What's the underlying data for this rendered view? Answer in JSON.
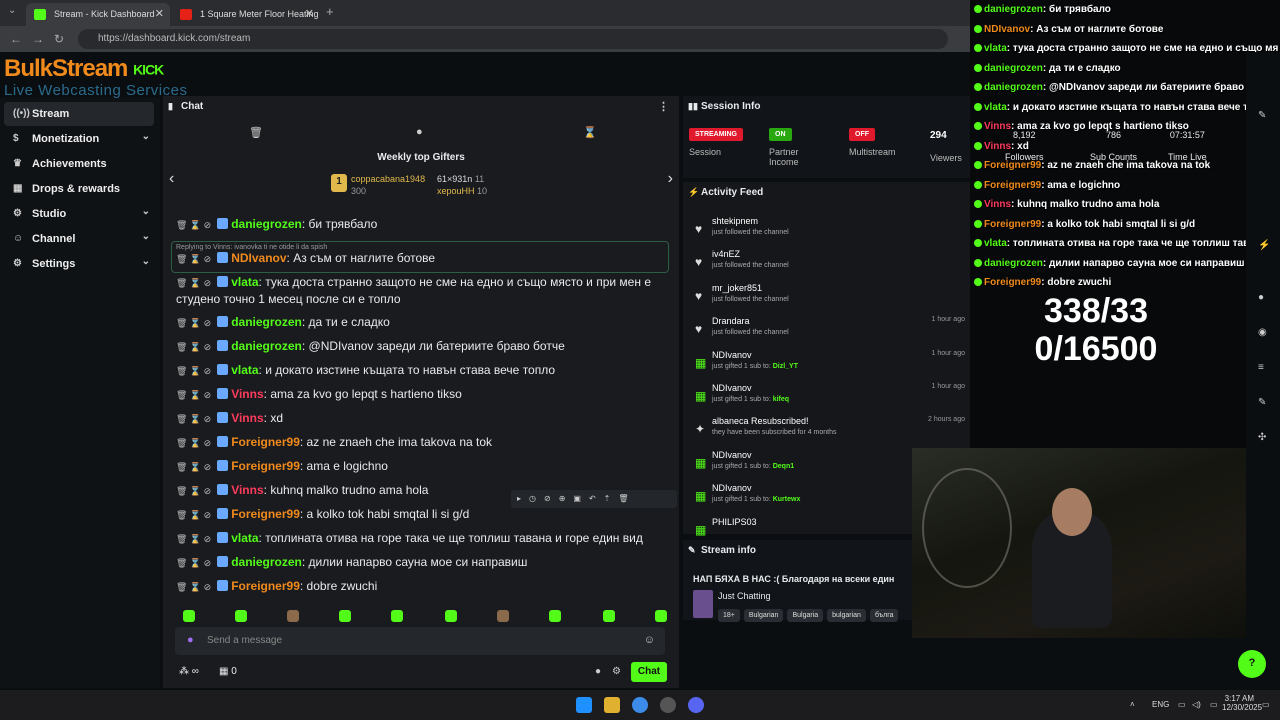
{
  "browser": {
    "tabs": [
      {
        "title": "Stream - Kick Dashboard"
      },
      {
        "title": "1 Square Meter Floor Heating"
      }
    ],
    "url": "https://dashboard.kick.com/stream"
  },
  "logo": {
    "line1": "BulkStream",
    "kick": "KICK",
    "line2": "Live Webcasting Services"
  },
  "sidebar": {
    "items": [
      {
        "label": "Stream",
        "icon": "radio-icon"
      },
      {
        "label": "Monetization",
        "icon": "dollar-icon"
      },
      {
        "label": "Achievements",
        "icon": "trophy-icon"
      },
      {
        "label": "Drops & rewards",
        "icon": "gift-icon"
      },
      {
        "label": "Studio",
        "icon": "gear-icon"
      },
      {
        "label": "Channel",
        "icon": "user-icon"
      },
      {
        "label": "Settings",
        "icon": "settings-icon"
      }
    ]
  },
  "chat": {
    "title": "Chat",
    "gifters_title": "Weekly top Gifters",
    "gifters": [
      {
        "name": "coppacabana1948",
        "count": "300"
      },
      {
        "name": "61×931n",
        "count": "11"
      },
      {
        "name": "хepouHH",
        "count": "10"
      }
    ],
    "reply_to": "Replying to Vinns: ivanovka ti ne otide li da spish",
    "messages": [
      {
        "user": "daniegrozen",
        "color": "#53fc18",
        "text": ": би трявбало"
      },
      {
        "user": "NDIvanov",
        "color": "#f08a1c",
        "text": ": Аз съм от наглите ботове"
      },
      {
        "user": "vlata",
        "color": "#53fc18",
        "text": ": тука доста странно защото не сме на едно и също място и при мен е студено точно 1 месец после си е топло"
      },
      {
        "user": "daniegrozen",
        "color": "#53fc18",
        "text": ": да ти е сладко"
      },
      {
        "user": "daniegrozen",
        "color": "#53fc18",
        "text": ": @NDIvanov зареди ли батериите браво ботче"
      },
      {
        "user": "vlata",
        "color": "#53fc18",
        "text": ": и докато изстине къщата то навън става вече топло"
      },
      {
        "user": "Vinns",
        "color": "#ff3b5c",
        "text": ": ama za kvo go lepqt s hartieno tikso"
      },
      {
        "user": "Vinns",
        "color": "#ff3b5c",
        "text": ": xd"
      },
      {
        "user": "Foreigner99",
        "color": "#f08a1c",
        "text": ": az ne znaeh che ima takova na tok"
      },
      {
        "user": "Foreigner99",
        "color": "#f08a1c",
        "text": ": ama e logichno"
      },
      {
        "user": "Vinns",
        "color": "#ff3b5c",
        "text": ": kuhnq malko trudno ama hola"
      },
      {
        "user": "Foreigner99",
        "color": "#f08a1c",
        "text": ": a kolko tok habi smqtal li si g/d"
      },
      {
        "user": "vlata",
        "color": "#53fc18",
        "text": ": топлината отива на горе така че ще топлиш тавана и горе един вид"
      },
      {
        "user": "daniegrozen",
        "color": "#53fc18",
        "text": ": дилии напарво сауна мое си направиш"
      },
      {
        "user": "Foreigner99",
        "color": "#f08a1c",
        "text": ": dobre zwuchi"
      }
    ],
    "input_placeholder": "Send a message",
    "infinity": "∞",
    "count": "0",
    "send_label": "Chat"
  },
  "session": {
    "title": "Session Info",
    "columns": [
      {
        "pill": "STREAMING",
        "pill_color": "#e0192d",
        "label": "Session"
      },
      {
        "pill": "ON",
        "pill_color": "#2aa80f",
        "label": "Partner Income"
      },
      {
        "pill": "OFF",
        "pill_color": "#e0192d",
        "label": "Multistream"
      },
      {
        "value": "294",
        "label": "Viewers"
      }
    ]
  },
  "activity": {
    "title": "Activity Feed",
    "filter_label": "Filter",
    "items": [
      {
        "icon": "heart-icon",
        "name": "shtekipnem",
        "sub": "just followed the channel",
        "time": ""
      },
      {
        "icon": "heart-icon",
        "name": "iv4nEZ",
        "sub": "just followed the channel",
        "time": ""
      },
      {
        "icon": "heart-icon",
        "name": "mr_joker851",
        "sub": "just followed the channel",
        "time": ""
      },
      {
        "icon": "heart-icon",
        "name": "Drandara",
        "sub": "just followed the channel",
        "time": "1 hour ago"
      },
      {
        "icon": "gift-icon",
        "name": "NDIvanov",
        "sub": "just gifted 1 sub to:",
        "target": "Dizl_YT",
        "time": "1 hour ago"
      },
      {
        "icon": "gift-icon",
        "name": "NDIvanov",
        "sub": "just gifted 1 sub to:",
        "target": "kifeq",
        "time": "1 hour ago"
      },
      {
        "icon": "star-icon",
        "name": "albaneca Resubscribed!",
        "sub": "they have been subscribed for 4 months",
        "time": "2 hours ago"
      },
      {
        "icon": "gift-icon",
        "name": "NDIvanov",
        "sub": "just gifted 1 sub to:",
        "target": "Deqn1",
        "time": ""
      },
      {
        "icon": "gift-icon",
        "name": "NDIvanov",
        "sub": "just gifted 1 sub to:",
        "target": "Kurtewx",
        "time": ""
      },
      {
        "icon": "gift-icon",
        "name": "PHILIPS03",
        "sub": "",
        "time": ""
      }
    ]
  },
  "stream_info": {
    "title": "Stream info",
    "stream_title": "НАП БЯХА В НАС :( Благодаря на всеки един",
    "category": "Just Chatting",
    "tags": [
      "18+",
      "Bulgarian",
      "Bulgaria",
      "bulgarian",
      "бълга"
    ]
  },
  "overlay": {
    "stats": {
      "followers": "8,192",
      "followers_label": "Followers",
      "subs": "786",
      "subs_label": "Sub Counts",
      "time": "07:31:57",
      "time_label": "Time Live"
    },
    "counter1": "338/33",
    "counter2": "0/16500",
    "chat": [
      {
        "user": "daniegrozen",
        "color": "#53fc18",
        "text": ": би трявбало"
      },
      {
        "user": "NDIvanov",
        "color": "#f08a1c",
        "text": ": Аз съм от наглите ботове"
      },
      {
        "user": "vlata",
        "color": "#53fc18",
        "text": ": тука доста странно защото не сме на едно и също мя"
      },
      {
        "user": "daniegrozen",
        "color": "#53fc18",
        "text": ": да ти е сладко"
      },
      {
        "user": "daniegrozen",
        "color": "#53fc18",
        "text": ": @NDIvanov зареди ли батериите браво ботче"
      },
      {
        "user": "vlata",
        "color": "#53fc18",
        "text": ": и докато изстине къщата то навън става вече топло"
      },
      {
        "user": "Vinns",
        "color": "#ff3b5c",
        "text": ": ama za kvo go lepqt s hartieno tikso"
      },
      {
        "user": "Vinns",
        "color": "#ff3b5c",
        "text": ": xd"
      },
      {
        "user": "Foreigner99",
        "color": "#f08a1c",
        "text": ": az ne znaeh che ima takova na tok"
      },
      {
        "user": "Foreigner99",
        "color": "#f08a1c",
        "text": ": ama e logichno"
      },
      {
        "user": "Vinns",
        "color": "#ff3b5c",
        "text": ": kuhnq malko trudno ama hola"
      },
      {
        "user": "Foreigner99",
        "color": "#f08a1c",
        "text": ": a kolko tok habi smqtal li si g/d"
      },
      {
        "user": "vlata",
        "color": "#53fc18",
        "text": ": топлината отива на горе така че ще топлиш тавана и горе"
      },
      {
        "user": "daniegrozen",
        "color": "#53fc18",
        "text": ": дилии напарво сауна мое си направиш"
      },
      {
        "user": "Foreigner99",
        "color": "#f08a1c",
        "text": ": dobre zwuchi"
      }
    ]
  },
  "taskbar": {
    "lang": "ENG",
    "time": "3:17 AM",
    "date": "12/30/2025"
  }
}
